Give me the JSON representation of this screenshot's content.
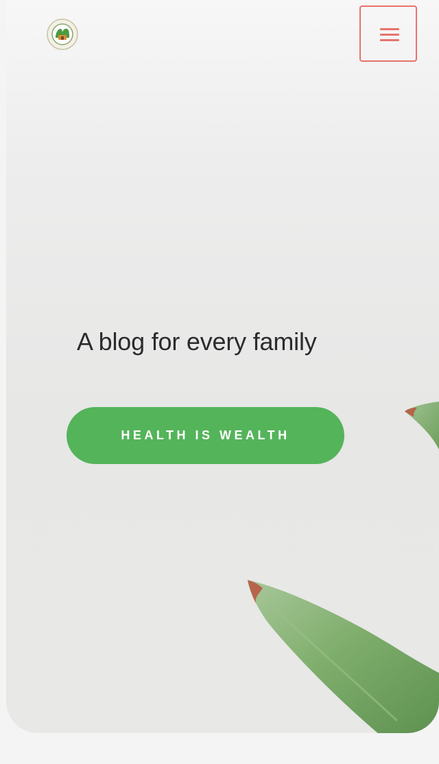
{
  "header": {
    "logo_alt": "site logo",
    "menu_label": "menu"
  },
  "hero": {
    "tagline": "A blog for every family",
    "cta_label": "HEALTH IS WEALTH"
  },
  "colors": {
    "accent": "#54b45a",
    "menu_border": "#e8736a",
    "text": "#2b2b2b",
    "leaf": "#7fae6c"
  },
  "icons": {
    "menu": "hamburger-icon",
    "logo": "logo-emblem-icon",
    "decor": "succulent-leaf-icon"
  }
}
